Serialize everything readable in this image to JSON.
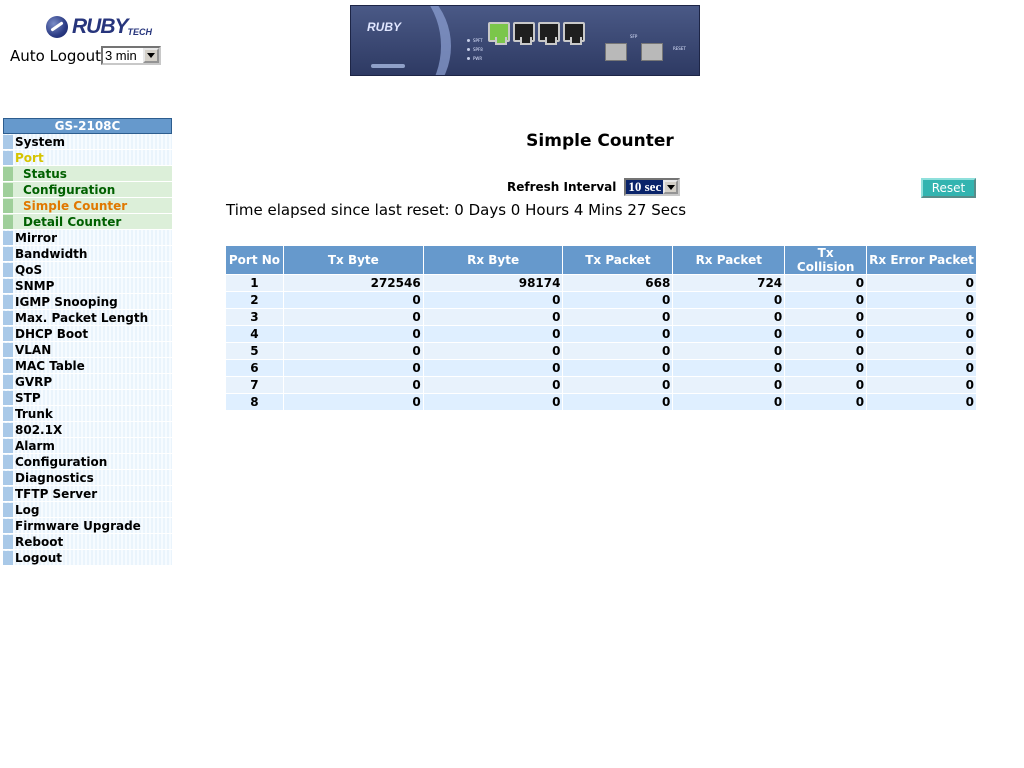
{
  "header": {
    "logo_text": "RUBY",
    "logo_sub": "TECH",
    "auto_logout_label": "Auto Logout",
    "auto_logout_value": "3 min"
  },
  "device": {
    "brand": "RUBY",
    "led_labels": [
      "SPFT",
      "SPF8",
      "PWR"
    ],
    "sfp_label": "SFP",
    "reset_label": "RESET"
  },
  "sidebar": {
    "title": "GS-2108C",
    "items": [
      {
        "label": "System"
      },
      {
        "label": "Port"
      },
      {
        "label": "Status"
      },
      {
        "label": "Configuration"
      },
      {
        "label": "Simple Counter"
      },
      {
        "label": "Detail Counter"
      },
      {
        "label": "Mirror"
      },
      {
        "label": "Bandwidth"
      },
      {
        "label": "QoS"
      },
      {
        "label": "SNMP"
      },
      {
        "label": "IGMP Snooping"
      },
      {
        "label": "Max. Packet Length"
      },
      {
        "label": "DHCP Boot"
      },
      {
        "label": "VLAN"
      },
      {
        "label": "MAC Table"
      },
      {
        "label": "GVRP"
      },
      {
        "label": "STP"
      },
      {
        "label": "Trunk"
      },
      {
        "label": "802.1X"
      },
      {
        "label": "Alarm"
      },
      {
        "label": "Configuration"
      },
      {
        "label": "Diagnostics"
      },
      {
        "label": "TFTP Server"
      },
      {
        "label": "Log"
      },
      {
        "label": "Firmware Upgrade"
      },
      {
        "label": "Reboot"
      },
      {
        "label": "Logout"
      }
    ]
  },
  "main": {
    "title": "Simple Counter",
    "refresh_label": "Refresh Interval",
    "refresh_value": "10 sec",
    "reset_label": "Reset",
    "elapsed": "Time elapsed since last reset: 0 Days 0 Hours 4 Mins 27 Secs",
    "table": {
      "headers": [
        "Port No",
        "Tx Byte",
        "Rx Byte",
        "Tx Packet",
        "Rx Packet",
        "Tx Collision",
        "Rx Error Packet"
      ],
      "rows": [
        [
          "1",
          "272546",
          "98174",
          "668",
          "724",
          "0",
          "0"
        ],
        [
          "2",
          "0",
          "0",
          "0",
          "0",
          "0",
          "0"
        ],
        [
          "3",
          "0",
          "0",
          "0",
          "0",
          "0",
          "0"
        ],
        [
          "4",
          "0",
          "0",
          "0",
          "0",
          "0",
          "0"
        ],
        [
          "5",
          "0",
          "0",
          "0",
          "0",
          "0",
          "0"
        ],
        [
          "6",
          "0",
          "0",
          "0",
          "0",
          "0",
          "0"
        ],
        [
          "7",
          "0",
          "0",
          "0",
          "0",
          "0",
          "0"
        ],
        [
          "8",
          "0",
          "0",
          "0",
          "0",
          "0",
          "0"
        ]
      ]
    }
  },
  "colors": {
    "header_blue": "#6699cc",
    "reset_teal": "#33b4b0",
    "selected_orange": "#e07800",
    "open_yellow": "#d6c400",
    "sub_green": "#006000"
  }
}
